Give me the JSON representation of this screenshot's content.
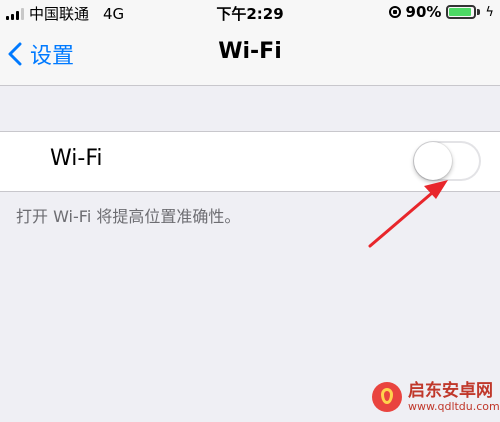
{
  "status_bar": {
    "carrier": "中国联通",
    "network": "4G",
    "time": "下午2:29",
    "battery_percent": "90%",
    "battery_level": 0.9,
    "signal_bars": 4,
    "signal_strength": 3,
    "icons": [
      "signal-icon",
      "orientation-lock-icon",
      "battery-icon",
      "charging-bolt-icon"
    ]
  },
  "nav": {
    "back_label": "设置",
    "title": "Wi-Fi"
  },
  "wifi_row": {
    "label": "Wi-Fi",
    "toggle_on": false
  },
  "footer_note": "打开 Wi-Fi 将提高位置准确性。",
  "watermark": {
    "title": "启东安卓网",
    "url": "www.qdltdu.com"
  },
  "colors": {
    "accent": "#007aff",
    "battery": "#4cd964",
    "annotation_arrow": "#e8262b",
    "background": "#efeff4"
  }
}
